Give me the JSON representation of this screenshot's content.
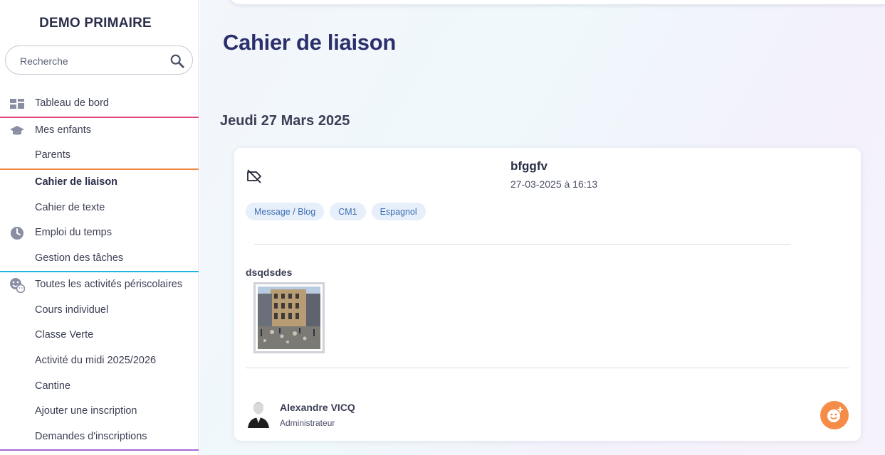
{
  "school": {
    "name": "DEMO PRIMAIRE"
  },
  "search": {
    "placeholder": "Recherche"
  },
  "sidebar": {
    "items": [
      {
        "label": "Tableau de bord",
        "icon": "dashboard-icon"
      },
      {
        "label": "Mes enfants",
        "icon": "graduation-cap-icon"
      },
      {
        "label": "Parents"
      },
      {
        "label": "Cahier de liaison",
        "active": true
      },
      {
        "label": "Cahier de texte"
      },
      {
        "label": "Emploi du temps",
        "icon": "clock-icon"
      },
      {
        "label": "Gestion des tâches"
      },
      {
        "label": "Toutes les activités périscolaires",
        "icon": "activities-icon"
      },
      {
        "label": "Cours individuel"
      },
      {
        "label": "Classe Verte"
      },
      {
        "label": "Activité du midi 2025/2026"
      },
      {
        "label": "Cantine"
      },
      {
        "label": "Ajouter une inscription"
      },
      {
        "label": "Demandes d'inscriptions"
      }
    ],
    "separator_colors": [
      "#e0457b",
      "#f0883e",
      "#1eb6e0",
      "#a46bd6"
    ]
  },
  "main": {
    "page_title": "Cahier de liaison",
    "date_heading": "Jeudi 27 Mars 2025",
    "post": {
      "title": "bfggfv",
      "datetime": "27-03-2025 à 16:13",
      "tags": [
        "Message / Blog",
        "CM1",
        "Espagnol"
      ],
      "body": "dsqdsdes",
      "author": {
        "name": "Alexandre VICQ",
        "role": "Administrateur"
      }
    }
  },
  "colors": {
    "title": "#2b2f6b",
    "chip_bg": "#e6effa",
    "chip_text": "#3f6fb5",
    "react_button": "#f58c47"
  }
}
